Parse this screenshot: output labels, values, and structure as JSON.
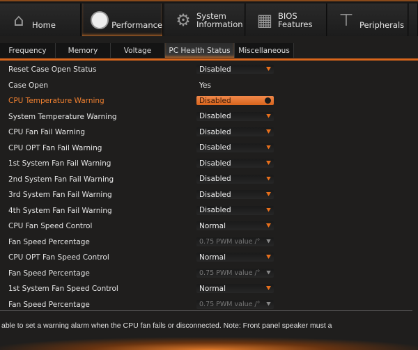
{
  "top_tabs": [
    {
      "label": "Home",
      "icon": "home-icon"
    },
    {
      "label": "Performance",
      "icon": "gauge-icon",
      "active": true
    },
    {
      "label": "System\nInformation",
      "l1": "System",
      "l2": "Information",
      "icon": "gear-icon"
    },
    {
      "label": "BIOS\nFeatures",
      "l1": "BIOS",
      "l2": "Features",
      "icon": "chip-icon"
    },
    {
      "label": "Peripherals",
      "icon": "peripherals-icon"
    }
  ],
  "sub_tabs": [
    "Frequency",
    "Memory",
    "Voltage",
    "PC Health Status",
    "Miscellaneous"
  ],
  "active_sub_tab": "PC Health Status",
  "settings": [
    {
      "label": "Reset Case Open Status",
      "value": "Disabled",
      "type": "dropdown"
    },
    {
      "label": "Case Open",
      "value": "Yes",
      "type": "text"
    },
    {
      "label": "CPU Temperature Warning",
      "value": "Disabled",
      "type": "dropdown",
      "selected": true
    },
    {
      "label": "System Temperature Warning",
      "value": "Disabled",
      "type": "dropdown"
    },
    {
      "label": "CPU Fan Fail Warning",
      "value": "Disabled",
      "type": "dropdown"
    },
    {
      "label": "CPU OPT Fan Fail Warning",
      "value": "Disabled",
      "type": "dropdown"
    },
    {
      "label": "1st System Fan Fail Warning",
      "value": "Disabled",
      "type": "dropdown"
    },
    {
      "label": "2nd System Fan Fail Warning",
      "value": "Disabled",
      "type": "dropdown"
    },
    {
      "label": "3rd System Fan Fail Warning",
      "value": "Disabled",
      "type": "dropdown"
    },
    {
      "label": "4th System Fan Fail Warning",
      "value": "Disabled",
      "type": "dropdown"
    },
    {
      "label": "CPU Fan Speed Control",
      "value": "Normal",
      "type": "dropdown"
    },
    {
      "label": "Fan Speed Percentage",
      "value": "0.75 PWM value /°",
      "type": "disabled"
    },
    {
      "label": "CPU OPT Fan Speed Control",
      "value": "Normal",
      "type": "dropdown"
    },
    {
      "label": "Fan Speed Percentage",
      "value": "0.75 PWM value /°",
      "type": "disabled"
    },
    {
      "label": "1st System Fan Speed Control",
      "value": "Normal",
      "type": "dropdown"
    },
    {
      "label": "Fan Speed Percentage",
      "value": "0.75 PWM value /°",
      "type": "disabled"
    }
  ],
  "help_text": "able to set a warning alarm when the CPU fan fails or disconnected. Note: Front panel speaker must a",
  "colors": {
    "accent": "#e07a2a",
    "highlight_text": "#f08030"
  }
}
